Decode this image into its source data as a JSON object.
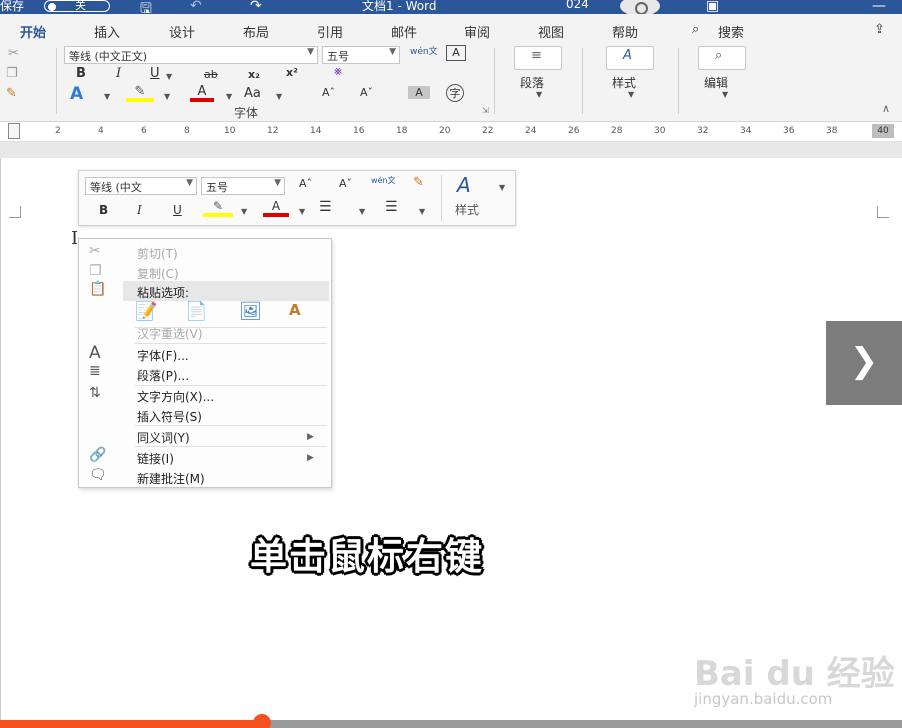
{
  "titlebar": {
    "autosave": "保存",
    "toggle_state": "关",
    "doc_title": "文档1 - Word",
    "partial_number": "024"
  },
  "ribbon_tabs": [
    "开始",
    "插入",
    "设计",
    "布局",
    "引用",
    "邮件",
    "审阅",
    "视图",
    "帮助"
  ],
  "search_label": "搜索",
  "font_group": {
    "font_name": "等线 (中文正文)",
    "font_size": "五号",
    "bold": "B",
    "italic": "I",
    "underline": "U",
    "strike": "ab",
    "subscript": "x₂",
    "superscript": "x²",
    "case": "Aa",
    "phonetic": "wén文",
    "label": "字体"
  },
  "paragraph_label": "段落",
  "styles_label": "样式",
  "editing_label": "编辑",
  "ruler_ticks": [
    "2",
    "4",
    "6",
    "8",
    "10",
    "12",
    "14",
    "16",
    "18",
    "20",
    "22",
    "24",
    "26",
    "28",
    "30",
    "32",
    "34",
    "36",
    "38",
    "40"
  ],
  "mini_toolbar": {
    "font_name": "等线 (中文",
    "font_size": "五号",
    "styles_label": "样式",
    "bold": "B",
    "italic": "I",
    "underline": "U"
  },
  "context_menu": {
    "cut": "剪切(T)",
    "copy": "复制(C)",
    "paste_options": "粘贴选项:",
    "hanzi_reconvert": "汉字重选(V)",
    "font": "字体(F)...",
    "paragraph": "段落(P)...",
    "text_direction": "文字方向(X)...",
    "insert_symbol": "插入符号(S)",
    "synonyms": "同义词(Y)",
    "link": "链接(I)",
    "new_comment": "新建批注(M)"
  },
  "caption": "单击鼠标右键",
  "watermark": {
    "logo": "Bai du 经验",
    "url": "jingyan.baidu.com"
  },
  "progress": {
    "fraction": 0.29
  },
  "colors": {
    "word_blue": "#2b579a",
    "progress": "#f4511e",
    "highlight": "#ffff00",
    "font_color": "#e00000"
  }
}
